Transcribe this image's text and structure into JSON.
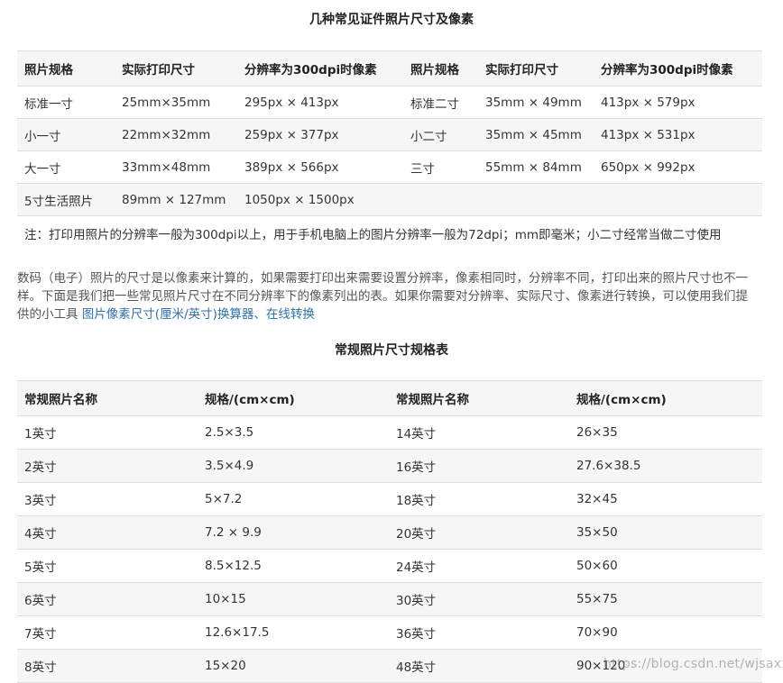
{
  "table1": {
    "title": "几种常见证件照片尺寸及像素",
    "headers": [
      "照片规格",
      "实际打印尺寸",
      "分辨率为300dpi时像素",
      "照片规格",
      "实际打印尺寸",
      "分辨率为300dpi时像素"
    ],
    "rows": [
      [
        "标准一寸",
        "25mm×35mm",
        "295px × 413px",
        "标准二寸",
        "35mm × 49mm",
        "413px × 579px"
      ],
      [
        "小一寸",
        "22mm×32mm",
        "259px × 377px",
        "小二寸",
        "35mm × 45mm",
        "413px × 531px"
      ],
      [
        "大一寸",
        "33mm×48mm",
        "389px × 566px",
        "三寸",
        "55mm × 84mm",
        "650px × 992px"
      ],
      [
        "5寸生活照片",
        "89mm × 127mm",
        "1050px × 1500px",
        "",
        "",
        ""
      ]
    ],
    "note": "注：打印用照片的分辨率一般为300dpi以上，用于手机电脑上的图片分辨率一般为72dpi；mm即毫米；小二寸经常当做二寸使用"
  },
  "paragraph": {
    "text": "数码（电子）照片的尺寸是以像素来计算的，如果需要打印出来需要设置分辨率，像素相同时，分辨率不同，打印出来的照片尺寸也不一样。下面是我们把一些常见照片尺寸在不同分辨率下的像素列出的表。如果你需要对分辨率、实际尺寸、像素进行转换，可以使用我们提供的小工具 ",
    "link1": "图片像素尺寸(厘米/英寸)换算器",
    "sep": "、",
    "link2": "在线转换"
  },
  "table2": {
    "title": "常规照片尺寸规格表",
    "headers": [
      "常规照片名称",
      "规格/(cm×cm)",
      "常规照片名称",
      "规格/(cm×cm)"
    ],
    "rows": [
      [
        "1英寸",
        "2.5×3.5",
        "14英寸",
        "26×35"
      ],
      [
        "2英寸",
        "3.5×4.9",
        "16英寸",
        "27.6×38.5"
      ],
      [
        "3英寸",
        "5×7.2",
        "18英寸",
        "32×45"
      ],
      [
        "4英寸",
        "7.2 × 9.9",
        "20英寸",
        "35×50"
      ],
      [
        "5英寸",
        "8.5×12.5",
        "24英寸",
        "50×60"
      ],
      [
        "6英寸",
        "10×15",
        "30英寸",
        "55×75"
      ],
      [
        "7英寸",
        "12.6×17.5",
        "36英寸",
        "70×90"
      ],
      [
        "8英寸",
        "15×20",
        "48英寸",
        "90×120"
      ]
    ]
  },
  "watermark": "https://blog.csdn.net/wjsaxx"
}
